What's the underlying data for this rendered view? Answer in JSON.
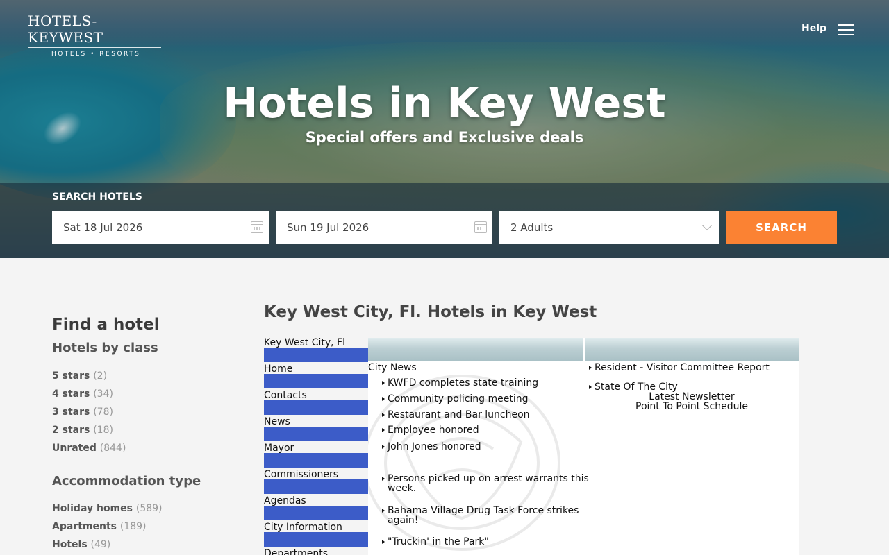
{
  "header": {
    "logo_main": "HOTELS-KEYWEST",
    "logo_sub": "HOTELS • RESORTS",
    "help_label": "Help",
    "menu_icon": "hamburger-menu-icon"
  },
  "hero": {
    "title": "Hotels in Key West",
    "subtitle": "Special offers and Exclusive deals"
  },
  "search": {
    "label": "SEARCH HOTELS",
    "checkin": "Sat 18 Jul 2026",
    "checkout": "Sun 19 Jul 2026",
    "guests": "2 Adults",
    "button": "SEARCH",
    "button_color": "#fb8233"
  },
  "sidebar": {
    "find_title": "Find a hotel",
    "class_title": "Hotels by class",
    "classes": [
      {
        "label": "5 stars",
        "count": "(2)"
      },
      {
        "label": "4 stars",
        "count": "(34)"
      },
      {
        "label": "3 stars",
        "count": "(78)"
      },
      {
        "label": "2 stars",
        "count": "(18)"
      },
      {
        "label": "Unrated",
        "count": "(844)"
      }
    ],
    "accom_title": "Accommodation type",
    "accommodation": [
      {
        "label": "Holiday homes",
        "count": "(589)"
      },
      {
        "label": "Apartments",
        "count": "(189)"
      },
      {
        "label": "Hotels",
        "count": "(49)"
      }
    ]
  },
  "main": {
    "heading": "Key West City, Fl. Hotels in Key West",
    "nav": [
      "Key West City, Fl",
      "Home",
      "Contacts",
      "News",
      "Mayor",
      "Commissioners",
      "Agendas",
      "City Information",
      "Departments"
    ],
    "nav_bar_color": "#3c5cc8",
    "news_title": "City News",
    "news": [
      "KWFD completes state training",
      "Community policing meeting",
      "Restaurant and Bar luncheon",
      "Employee honored",
      "John Jones honored",
      "Persons picked up on arrest warrants this week.",
      "Bahama Village Drug Task Force strikes again!",
      "\"Truckin' in the Park\""
    ],
    "right_links": [
      "Resident - Visitor Committee Report",
      "State Of The City"
    ],
    "right_center": [
      "Latest Newsletter",
      "Point To Point Schedule"
    ]
  }
}
